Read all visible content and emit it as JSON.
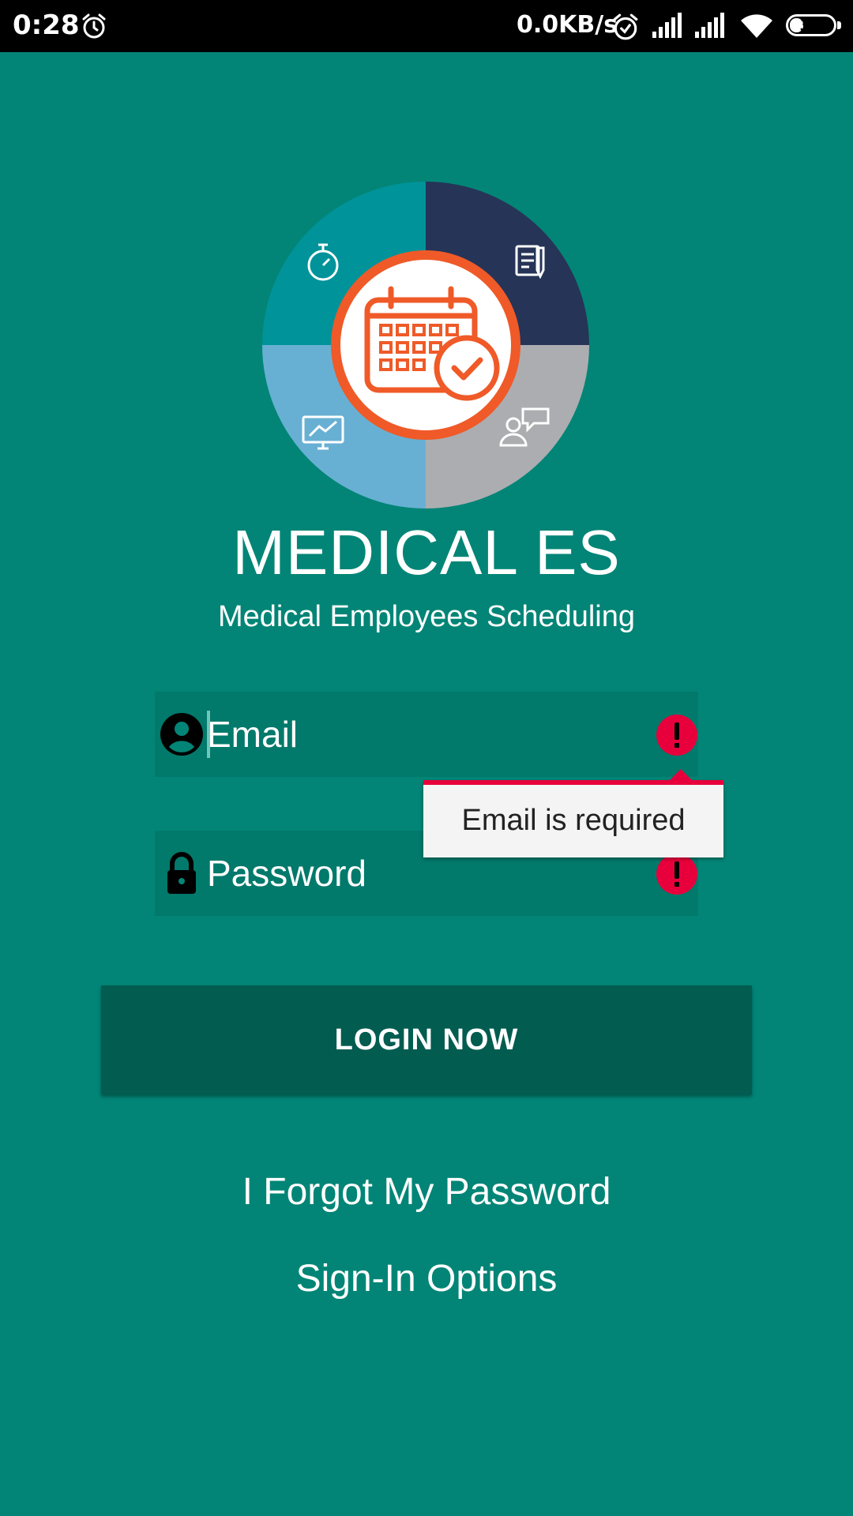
{
  "status_bar": {
    "time": "0:28",
    "network_speed": "0.0KB/s",
    "battery": "37",
    "battery_level_fraction": 0.37
  },
  "app": {
    "title": "MEDICAL ES",
    "subtitle": "Medical Employees Scheduling"
  },
  "login_form": {
    "email_placeholder": "Email",
    "email_value": "",
    "password_placeholder": "Password",
    "password_value": "",
    "email_error": "Email is required",
    "login_label": "LOGIN NOW"
  },
  "links": {
    "forgot_password": "I Forgot My Password",
    "sign_in_options": "Sign-In Options"
  },
  "colors": {
    "background": "#028576",
    "button": "#025c50",
    "error": "#e8003c",
    "logo_teal": "#00939a",
    "logo_navy": "#263457",
    "logo_light_blue": "#68b0d3",
    "logo_gray": "#acadb1",
    "logo_orange": "#ef5a28"
  },
  "icons": {
    "email_field": "account-circle-icon",
    "password_field": "lock-icon",
    "error": "error-icon"
  }
}
